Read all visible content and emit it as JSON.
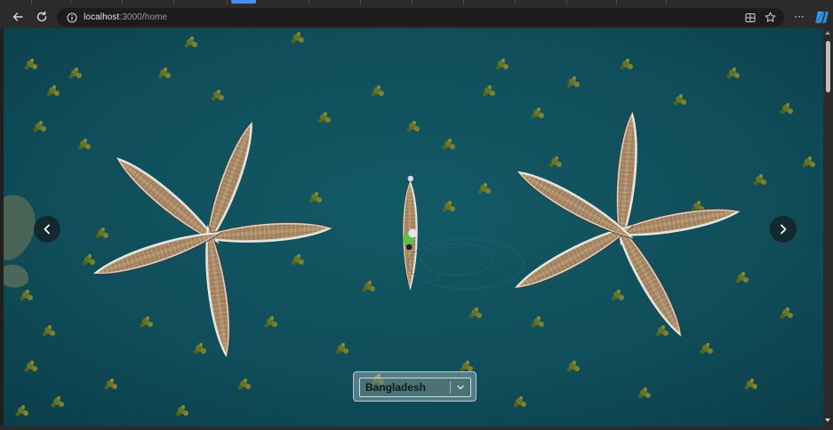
{
  "browser": {
    "address_bar": {
      "host": "localhost",
      "path": ":3000/home"
    },
    "toolbar_icons": {
      "back": "arrow-left-icon",
      "reload": "reload-icon",
      "site_info": "info-icon",
      "split_screen": "split-screen-icon",
      "favorite": "star-icon",
      "menu": "more-icon",
      "menu_glyph": "···",
      "copilot": "copilot-icon"
    }
  },
  "page": {
    "hero": {
      "image": "aerial-boats-photo",
      "prev_icon": "chevron-left-icon",
      "next_icon": "chevron-right-icon"
    },
    "country_select": {
      "selected": "Bangladesh",
      "icon": "chevron-down-icon"
    }
  },
  "colors": {
    "water": "#0f4f5c",
    "chrome": "#2b2b2b",
    "omnibox": "#1c1c1c",
    "accent_tab": "#4c8cf5"
  }
}
